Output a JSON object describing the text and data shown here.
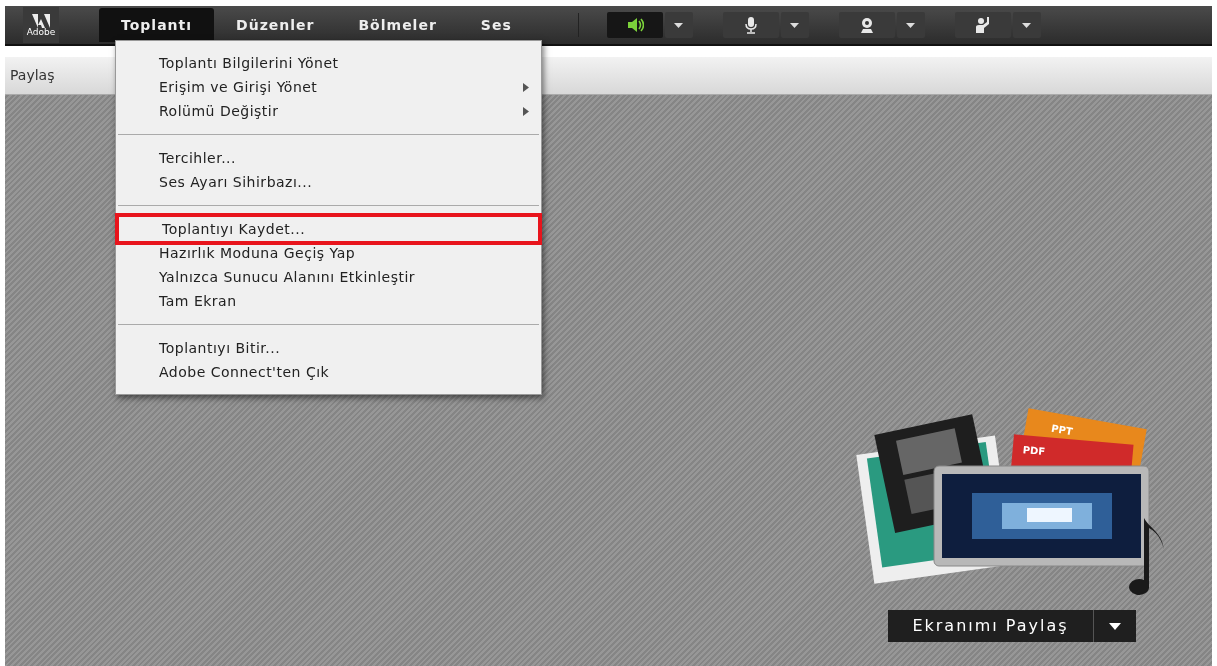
{
  "logo": {
    "label": "Adobe"
  },
  "menu_bar": [
    {
      "label": "Toplantı",
      "selected": true
    },
    {
      "label": "Düzenler",
      "selected": false
    },
    {
      "label": "Bölmeler",
      "selected": false
    },
    {
      "label": "Ses",
      "selected": false
    }
  ],
  "toolbar": [
    {
      "kind": "speaker",
      "on": true
    },
    {
      "kind": "microphone",
      "on": false
    },
    {
      "kind": "camera",
      "on": false
    },
    {
      "kind": "raise-hand",
      "on": false
    }
  ],
  "menu": [
    [
      {
        "label": "Toplantı Bilgilerini Yönet",
        "submenu": false,
        "highlighted": false
      },
      {
        "label": "Erişim ve Girişi Yönet",
        "submenu": true,
        "highlighted": false
      },
      {
        "label": "Rolümü Değiştir",
        "submenu": true,
        "highlighted": false
      }
    ],
    [
      {
        "label": "Tercihler...",
        "submenu": false,
        "highlighted": false
      },
      {
        "label": "Ses Ayarı Sihirbazı...",
        "submenu": false,
        "highlighted": false
      }
    ],
    [
      {
        "label": "Toplantıyı Kaydet...",
        "submenu": false,
        "highlighted": true
      },
      {
        "label": "Hazırlık Moduna Geçiş Yap",
        "submenu": false,
        "highlighted": false
      },
      {
        "label": "Yalnızca Sunucu Alanını Etkinleştir",
        "submenu": false,
        "highlighted": false
      },
      {
        "label": "Tam Ekran",
        "submenu": false,
        "highlighted": false
      }
    ],
    [
      {
        "label": "Toplantıyı Bitir...",
        "submenu": false,
        "highlighted": false
      },
      {
        "label": "Adobe Connect'ten Çık",
        "submenu": false,
        "highlighted": false
      }
    ]
  ],
  "pod": {
    "title": "Paylaş",
    "doc_labels": [
      "PPT",
      "PDF"
    ],
    "share_button": "Ekranımı Paylaş"
  }
}
